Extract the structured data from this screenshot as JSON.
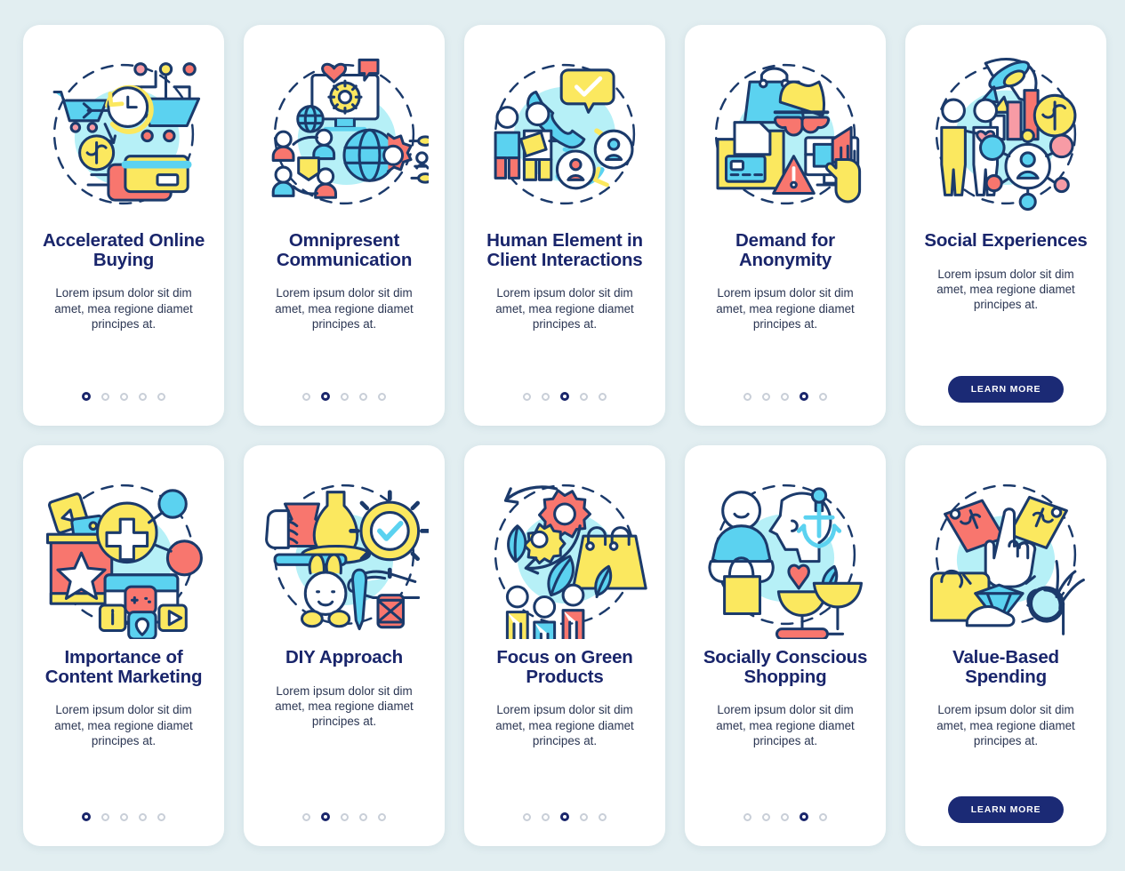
{
  "page": {
    "background_color": "#e2eef1",
    "card_background": "#ffffff",
    "title_color": "#19256b",
    "body_color": "#2a3552",
    "accent_color": "#1b2a75",
    "palette": {
      "cyan": "#5bd2f0",
      "light_cyan": "#a9eef8",
      "blob": "#b6f0f7",
      "yellow": "#fbe85f",
      "coral": "#f8766e",
      "pink": "#f79ba5",
      "outline": "#1b3a6b"
    }
  },
  "body_text": "Lorem ipsum dolor sit dim amet, mea regione diamet principes at.",
  "cta_label": "LEARN MORE",
  "rows": [
    {
      "cards": [
        {
          "title": "Accelerated Online Buying",
          "illustration": "online-shopping-illustration",
          "dots": {
            "count": 5,
            "active": 0
          },
          "cta": false
        },
        {
          "title": "Omnipresent Communication",
          "illustration": "global-communication-illustration",
          "dots": {
            "count": 5,
            "active": 1
          },
          "cta": false
        },
        {
          "title": "Human Element in Client Interactions",
          "illustration": "client-interaction-illustration",
          "dots": {
            "count": 5,
            "active": 2
          },
          "cta": false
        },
        {
          "title": "Demand for Anonymity",
          "illustration": "anonymity-privacy-illustration",
          "dots": {
            "count": 5,
            "active": 3
          },
          "cta": false
        },
        {
          "title": "Social Experiences",
          "illustration": "social-network-growth-illustration",
          "dots": null,
          "cta": true
        }
      ]
    },
    {
      "cards": [
        {
          "title": "Importance of Content Marketing",
          "illustration": "content-marketing-illustration",
          "dots": {
            "count": 5,
            "active": 0
          },
          "cta": false
        },
        {
          "title": "DIY Approach",
          "illustration": "diy-crafts-illustration",
          "dots": {
            "count": 5,
            "active": 1
          },
          "cta": false
        },
        {
          "title": "Focus on Green Products",
          "illustration": "green-products-illustration",
          "dots": {
            "count": 5,
            "active": 2
          },
          "cta": false
        },
        {
          "title": "Socially Conscious Shopping",
          "illustration": "conscious-shopping-illustration",
          "dots": {
            "count": 5,
            "active": 3
          },
          "cta": false
        },
        {
          "title": "Value-Based Spending",
          "illustration": "value-spending-illustration",
          "dots": null,
          "cta": true
        }
      ]
    }
  ]
}
